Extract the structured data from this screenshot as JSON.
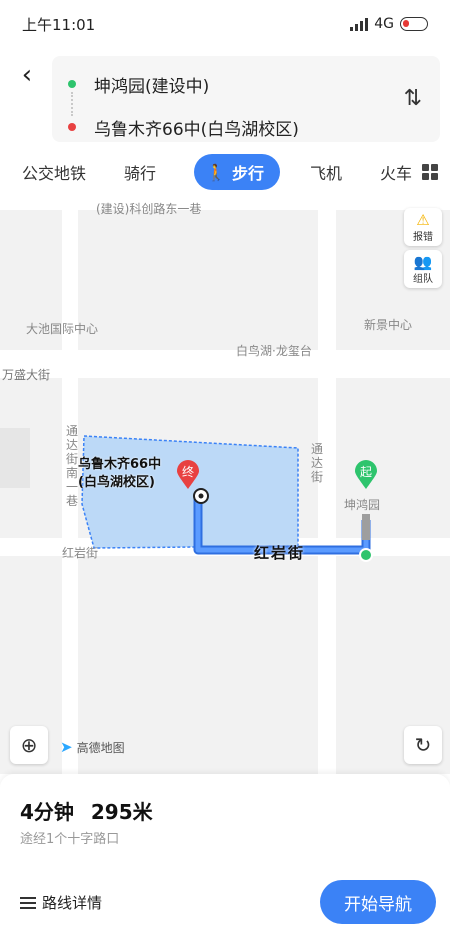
{
  "status_bar": {
    "time": "上午11:01",
    "network": "4G"
  },
  "header": {
    "origin": "坤鸿园(建设中)",
    "destination": "乌鲁木齐66中(白鸟湖校区)",
    "back_icon": "back-arrow-icon",
    "swap_icon": "swap-icon"
  },
  "tabs": {
    "items": [
      "公交地铁",
      "骑行",
      "步行",
      "飞机",
      "火车"
    ],
    "active": "步行",
    "more_icon": "grid-icon"
  },
  "map": {
    "labels": {
      "science_road": "(建设)科创路东一巷",
      "dachi": "大池国际中心",
      "xinjing": "新景中心",
      "bainiaohu": "白鸟湖·龙玺台",
      "wansheng": "万盛大街",
      "tongda_south": "通达街南一巷",
      "hongyan_left": "红岩街",
      "tongda": "通达街",
      "kunhongyuan": "坤鸿园",
      "hongyan_main": "红岩街"
    },
    "dest_label_line1": "乌鲁木齐66中",
    "dest_label_line2": "(白鸟湖校区)",
    "end_marker": "终",
    "start_marker": "起",
    "report_label": "报错",
    "team_label": "组队",
    "brand": "高德地图",
    "colors": {
      "route": "#3b82f6",
      "area": "#bcd9f7",
      "start": "#2ec46d",
      "end": "#e84141"
    }
  },
  "summary": {
    "duration": "4分钟",
    "distance": "295米",
    "via": "途经1个十字路口",
    "details_label": "路线详情",
    "start_nav_label": "开始导航"
  }
}
